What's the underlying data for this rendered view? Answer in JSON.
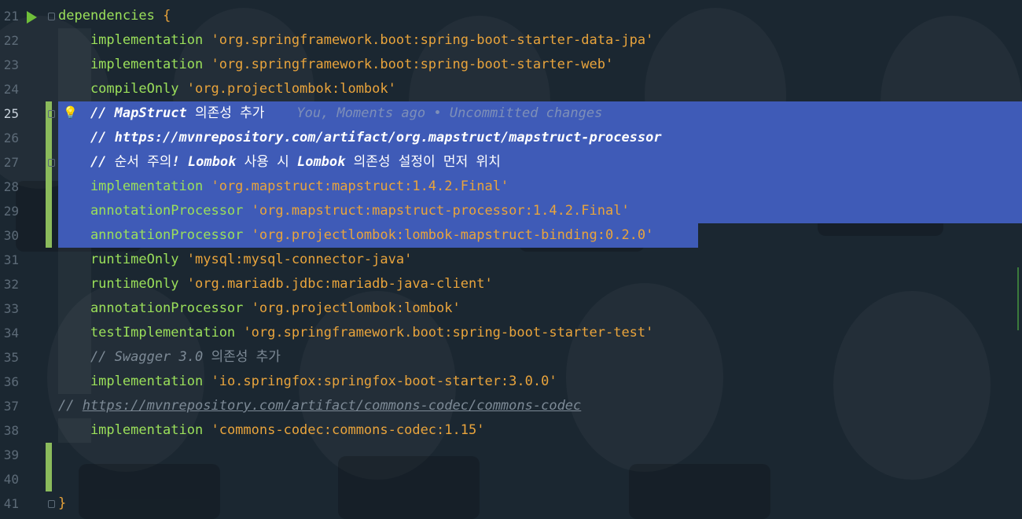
{
  "lines": [
    {
      "num": "21",
      "tokens": [
        {
          "t": "dependencies",
          "c": "fn"
        },
        {
          "t": " ",
          "c": ""
        },
        {
          "t": "{",
          "c": "brace"
        }
      ]
    },
    {
      "num": "22",
      "tokens": [
        {
          "t": "    implementation ",
          "c": "fn"
        },
        {
          "t": "'org.springframework.boot:spring-boot-starter-data-jpa'",
          "c": "str"
        }
      ]
    },
    {
      "num": "23",
      "tokens": [
        {
          "t": "    implementation ",
          "c": "fn"
        },
        {
          "t": "'org.springframework.boot:spring-boot-starter-web'",
          "c": "str"
        }
      ]
    },
    {
      "num": "24",
      "tokens": [
        {
          "t": "    compileOnly ",
          "c": "fn"
        },
        {
          "t": "'org.projectlombok:lombok'",
          "c": "str"
        }
      ]
    },
    {
      "num": "25",
      "tokens": [
        {
          "t": "    // MapStruct ",
          "c": "cmt-sel"
        },
        {
          "t": "의존성 추가",
          "c": "cmt-sel ko"
        },
        {
          "t": "    You, Moments ago • Uncommitted changes",
          "c": "blame"
        }
      ]
    },
    {
      "num": "26",
      "tokens": [
        {
          "t": "    // https://mvnrepository.com/artifact/org.mapstruct/mapstruct-processor",
          "c": "cmt-sel"
        }
      ]
    },
    {
      "num": "27",
      "tokens": [
        {
          "t": "    // ",
          "c": "cmt-sel"
        },
        {
          "t": "순서 주의",
          "c": "cmt-sel ko"
        },
        {
          "t": "! Lombok ",
          "c": "cmt-sel"
        },
        {
          "t": "사용 시",
          "c": "cmt-sel ko"
        },
        {
          "t": " Lombok ",
          "c": "cmt-sel"
        },
        {
          "t": "의존성 설정이 먼저 위치",
          "c": "cmt-sel ko"
        }
      ]
    },
    {
      "num": "28",
      "tokens": [
        {
          "t": "    implementation ",
          "c": "fn"
        },
        {
          "t": "'org.mapstruct:mapstruct:1.4.2.Final'",
          "c": "str"
        }
      ]
    },
    {
      "num": "29",
      "tokens": [
        {
          "t": "    annotationProcessor ",
          "c": "fn"
        },
        {
          "t": "'org.mapstruct:mapstruct-processor:1.4.2.Final'",
          "c": "str"
        }
      ]
    },
    {
      "num": "30",
      "tokens": [
        {
          "t": "    annotationProcessor ",
          "c": "fn"
        },
        {
          "t": "'org.projectlombok:lombok-mapstruct-binding:0.2.0'",
          "c": "str"
        }
      ]
    },
    {
      "num": "31",
      "tokens": [
        {
          "t": "    runtimeOnly ",
          "c": "fn"
        },
        {
          "t": "'mysql:mysql-connector-java'",
          "c": "str"
        }
      ]
    },
    {
      "num": "32",
      "tokens": [
        {
          "t": "    runtimeOnly ",
          "c": "fn"
        },
        {
          "t": "'org.mariadb.jdbc:mariadb-java-client'",
          "c": "str"
        }
      ]
    },
    {
      "num": "33",
      "tokens": [
        {
          "t": "    annotationProcessor ",
          "c": "fn"
        },
        {
          "t": "'org.projectlombok:lombok'",
          "c": "str"
        }
      ]
    },
    {
      "num": "34",
      "tokens": [
        {
          "t": "    testImplementation ",
          "c": "fn"
        },
        {
          "t": "'org.springframework.boot:spring-boot-starter-test'",
          "c": "str"
        }
      ]
    },
    {
      "num": "35",
      "tokens": [
        {
          "t": "    // Swagger 3.0 ",
          "c": "cmt"
        },
        {
          "t": "의존성 추가",
          "c": "cmt ko"
        }
      ]
    },
    {
      "num": "36",
      "tokens": [
        {
          "t": "    implementation ",
          "c": "fn"
        },
        {
          "t": "'io.springfox:springfox-boot-starter:3.0.0'",
          "c": "str"
        }
      ]
    },
    {
      "num": "37",
      "tokens": [
        {
          "t": "// ",
          "c": "cmt"
        },
        {
          "t": "https://mvnrepository.com/artifact/commons-codec/commons-codec",
          "c": "cmt link"
        }
      ]
    },
    {
      "num": "38",
      "tokens": [
        {
          "t": "    implementation ",
          "c": "fn"
        },
        {
          "t": "'commons-codec:commons-codec:1.15'",
          "c": "str"
        }
      ]
    },
    {
      "num": "39",
      "tokens": []
    },
    {
      "num": "40",
      "tokens": []
    },
    {
      "num": "41",
      "tokens": [
        {
          "t": "}",
          "c": "brace"
        }
      ]
    }
  ],
  "current_line": "25",
  "colors": {
    "background": "#1b2731",
    "selection": "#3f5bb7",
    "string": "#e9a43c",
    "keyword": "#9be05a",
    "comment": "#7d8a96",
    "change_bar": "#8bbb5c"
  },
  "icons": {
    "run": "run-gutter-icon",
    "bulb": "lightbulb-icon",
    "fold": "fold-icon"
  }
}
